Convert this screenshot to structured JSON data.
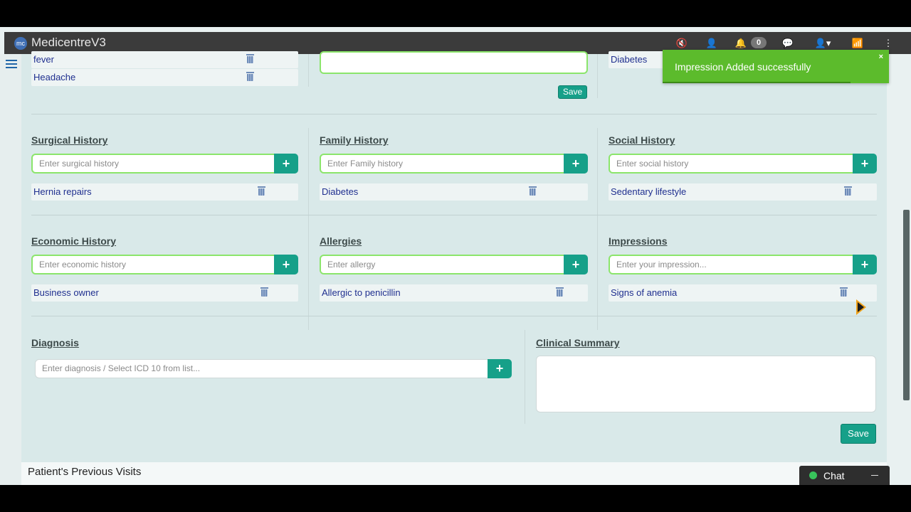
{
  "app": {
    "logo_text": "mc",
    "title": "MedicentreV3"
  },
  "topbar": {
    "notification_count": "0"
  },
  "top_partial": {
    "complaints": [
      {
        "label": "fever"
      },
      {
        "label": "Headache"
      }
    ],
    "save_label": "Save",
    "right_item": "Diabetes"
  },
  "sections": {
    "surgical": {
      "title": "Surgical History",
      "placeholder": "Enter surgical history",
      "items": [
        "Hernia repairs"
      ]
    },
    "family": {
      "title": "Family History",
      "placeholder": "Enter Family history",
      "items": [
        "Diabetes"
      ]
    },
    "social": {
      "title": "Social History",
      "placeholder": "Enter social history",
      "items": [
        "Sedentary lifestyle"
      ]
    },
    "economic": {
      "title": "Economic History",
      "placeholder": "Enter economic history",
      "items": [
        "Business owner"
      ]
    },
    "allergies": {
      "title": "Allergies",
      "placeholder": "Enter allergy",
      "items": [
        "Allergic to penicillin"
      ]
    },
    "impressions": {
      "title": "Impressions",
      "placeholder": "Enter your impression...",
      "items": [
        "Signs of anemia"
      ]
    }
  },
  "diagnosis": {
    "title": "Diagnosis",
    "placeholder": "Enter diagnosis / Select ICD 10 from list..."
  },
  "clinical_summary": {
    "title": "Clinical Summary",
    "value": "",
    "save_label": "Save"
  },
  "toast": {
    "message": "Impression Added successfully",
    "close": "×",
    "progress": 0.83
  },
  "previous_visits": {
    "title": "Patient's Previous Visits"
  },
  "chat": {
    "label": "Chat",
    "status_color": "#38c45b"
  },
  "colors": {
    "accent": "#16a089",
    "toast": "#5cbb2c",
    "topbar": "#3b3b3b",
    "input_focus_border": "#8be56b",
    "item_text": "#1f2f8f"
  },
  "icons": [
    "hamburger-icon",
    "mute-icon",
    "user-icon",
    "bell-icon",
    "chat-bubbles-icon",
    "user-dropdown-icon",
    "wifi-icon",
    "kebab-icon",
    "plus-icon",
    "trash-icon",
    "close-icon"
  ]
}
